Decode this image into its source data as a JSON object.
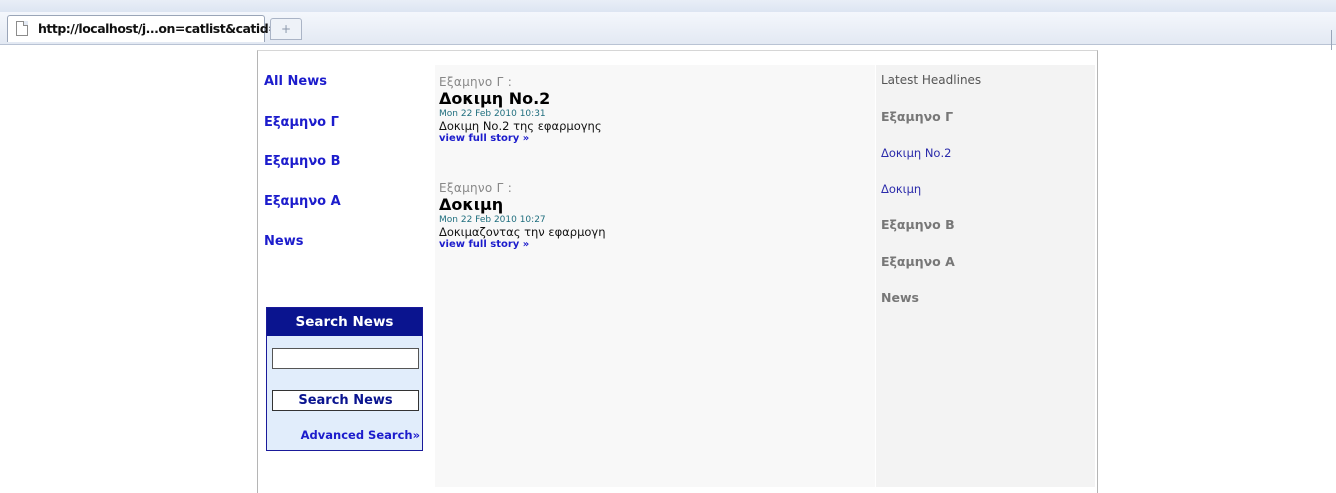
{
  "browser": {
    "tab_title": "http://localhost/j...on=catlist&catid=4",
    "new_tab_symbol": "+"
  },
  "sidebar": {
    "items": [
      {
        "label": "All News"
      },
      {
        "label": "Εξαμηνο Γ"
      },
      {
        "label": "Εξαμηνο Β"
      },
      {
        "label": "Εξαμηνο Α"
      },
      {
        "label": "News"
      }
    ]
  },
  "search": {
    "header": "Search News",
    "input_value": "",
    "button_label": "Search News",
    "advanced_link": "Advanced Search»"
  },
  "articles": [
    {
      "category": "Εξαμηνο Γ :",
      "title": "Δοκιμη Νο.2",
      "date": "Mon 22 Feb 2010 10:31",
      "summary": "Δοκιμη Νο.2 της εφαρμογης",
      "more": "view full story »"
    },
    {
      "category": "Εξαμηνο Γ :",
      "title": "Δοκιμη",
      "date": "Mon 22 Feb 2010 10:27",
      "summary": "Δοκιμαζοντας την εφαρμογη",
      "more": "view full story »"
    }
  ],
  "headlines": {
    "heading": "Latest Headlines",
    "cat_g": "Εξαμηνο Γ",
    "items": [
      {
        "label": "Δοκιμη Νο.2"
      },
      {
        "label": "Δοκιμη"
      }
    ],
    "cat_b": "Εξαμηνο Β",
    "cat_a": "Εξαμηνο Α",
    "cat_news": "News"
  },
  "colors": {
    "link": "#1c1ccc",
    "search_header": "#0a148f",
    "search_bg": "#e1edfb",
    "date": "#1f6e7e"
  }
}
